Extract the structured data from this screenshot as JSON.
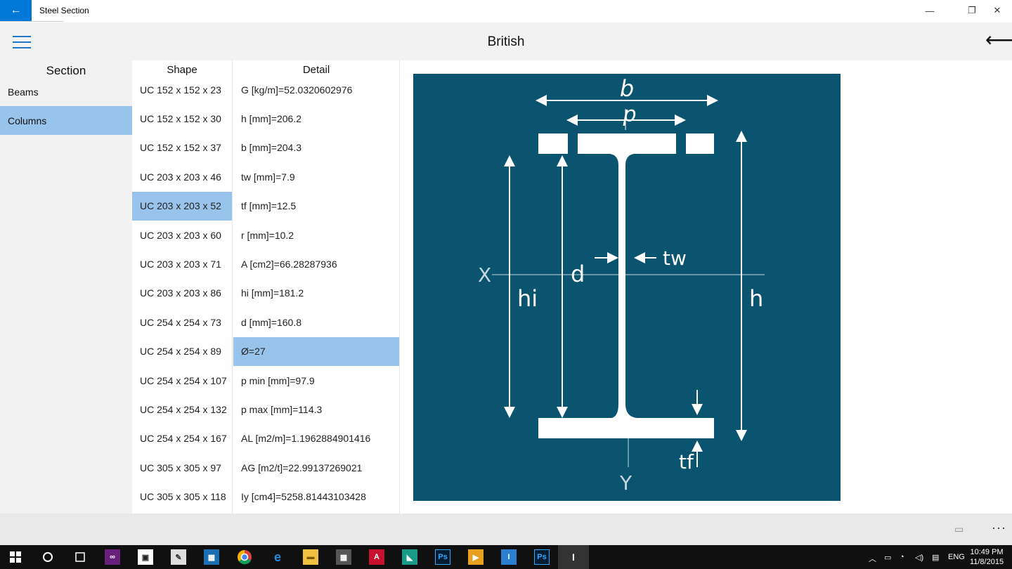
{
  "window": {
    "title": "Steel Section",
    "back_glyph": "←",
    "minimize_glyph": "—",
    "restore_glyph": "❐",
    "close_glyph": "✕"
  },
  "header": {
    "title": "British",
    "back_glyph": "⟵"
  },
  "nav": {
    "heading": "Section",
    "items": [
      {
        "label": "Beams",
        "selected": false
      },
      {
        "label": "Columns",
        "selected": true
      }
    ]
  },
  "shape_list": {
    "heading": "Shape",
    "items": [
      "UC 152 x 152 x 23",
      "UC 152 x 152 x 30",
      "UC 152 x 152 x 37",
      "UC 203 x 203 x 46",
      "UC 203 x 203 x 52",
      "UC 203 x 203 x 60",
      "UC 203 x 203 x 71",
      "UC 203 x 203 x 86",
      "UC 254 x 254 x 73",
      "UC 254 x 254 x 89",
      "UC 254 x 254 x 107",
      "UC 254 x 254 x 132",
      "UC 254 x 254 x 167",
      "UC 305 x 305 x 97",
      "UC 305 x 305 x 118"
    ],
    "selected_index": 4
  },
  "detail_list": {
    "heading": "Detail",
    "items": [
      "G [kg/m]=52.0320602976",
      "h [mm]=206.2",
      "b [mm]=204.3",
      "tw [mm]=7.9",
      "tf [mm]=12.5",
      "r [mm]=10.2",
      "A [cm2]=66.28287936",
      "hi [mm]=181.2",
      "d [mm]=160.8",
      "Ø=27",
      "p min [mm]=97.9",
      "p max [mm]=114.3",
      "AL [m2/m]=1.1962884901416",
      "AG [m2/t]=22.99137269021",
      "Iy [cm4]=5258.81443103428"
    ],
    "selected_index": 9
  },
  "diagram": {
    "label_b": "b",
    "label_p": "p",
    "label_tw": "tw",
    "label_x": "X",
    "label_d": "d",
    "label_hi": "hi",
    "label_h": "h",
    "label_tf": "tf",
    "label_y": "Y",
    "background_color": "#0b5470"
  },
  "taskbar": {
    "icons": [
      "windows-start-icon",
      "cortana-icon",
      "task-view-icon",
      "visual-studio-icon",
      "store-icon",
      "paint-icon",
      "app-icon",
      "chrome-icon",
      "edge-icon",
      "file-explorer-icon",
      "calculator-icon",
      "autocad-icon",
      "app-icon-2",
      "photoshop-icon",
      "media-player-icon",
      "app-icon-3",
      "photoshop-icon-2",
      "steel-section-icon"
    ],
    "language": "ENG",
    "time": "10:49 PM",
    "date": "11/8/2015"
  }
}
